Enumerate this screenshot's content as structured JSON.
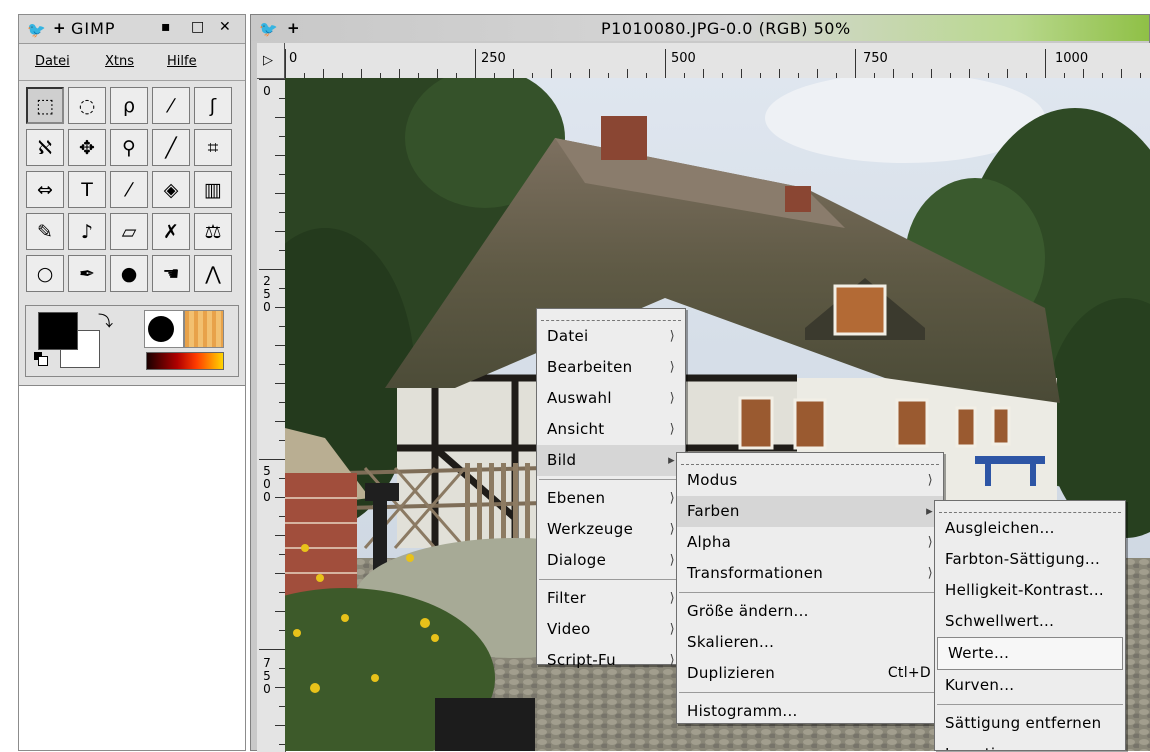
{
  "toolbox": {
    "title": "GIMP",
    "title_buttons": [
      "▪",
      "□",
      "✕"
    ],
    "menu": [
      "Datei",
      "Xtns",
      "Hilfe"
    ],
    "tools": [
      {
        "name": "rect-select-icon",
        "glyph": "⬚"
      },
      {
        "name": "ellipse-select-icon",
        "glyph": "◌"
      },
      {
        "name": "lasso-icon",
        "glyph": "ρ"
      },
      {
        "name": "magic-wand-icon",
        "glyph": "⁄"
      },
      {
        "name": "scissors-select-icon",
        "glyph": "ʃ"
      },
      {
        "name": "bezier-path-icon",
        "glyph": "ℵ"
      },
      {
        "name": "move-icon",
        "glyph": "✥"
      },
      {
        "name": "zoom-icon",
        "glyph": "⚲"
      },
      {
        "name": "measure-icon",
        "glyph": "╱"
      },
      {
        "name": "crop-icon",
        "glyph": "⌗"
      },
      {
        "name": "flip-icon",
        "glyph": "⇔"
      },
      {
        "name": "text-icon",
        "glyph": "T"
      },
      {
        "name": "color-picker-icon",
        "glyph": "⁄"
      },
      {
        "name": "bucket-fill-icon",
        "glyph": "◈"
      },
      {
        "name": "blend-icon",
        "glyph": "▥"
      },
      {
        "name": "pencil-icon",
        "glyph": "✎"
      },
      {
        "name": "paintbrush-icon",
        "glyph": "♪"
      },
      {
        "name": "eraser-icon",
        "glyph": "▱"
      },
      {
        "name": "airbrush-icon",
        "glyph": "✗"
      },
      {
        "name": "clone-icon",
        "glyph": "⚖"
      },
      {
        "name": "blur-icon",
        "glyph": "○"
      },
      {
        "name": "ink-icon",
        "glyph": "✒"
      },
      {
        "name": "dodge-burn-icon",
        "glyph": "●"
      },
      {
        "name": "smudge-icon",
        "glyph": "☚"
      },
      {
        "name": "measure-compass-icon",
        "glyph": "⋀"
      }
    ]
  },
  "image_window": {
    "title": "P1010080.JPG-0.0 (RGB) 50%",
    "corner_glyph": "▷",
    "hruler_labels": [
      "0",
      "250",
      "500",
      "750",
      "1000"
    ],
    "vruler_labels": [
      "0",
      "250",
      "500",
      "750"
    ]
  },
  "menus": {
    "main": [
      "Datei",
      "Bearbeiten",
      "Auswahl",
      "Ansicht",
      "Bild",
      "Ebenen",
      "Werkzeuge",
      "Dialoge",
      "Filter",
      "Video",
      "Script-Fu"
    ],
    "bild": [
      "Modus",
      "Farben",
      "Alpha",
      "Transformationen",
      "Größe ändern...",
      "Skalieren...",
      "Duplizieren",
      "Histogramm..."
    ],
    "bild_accel": "Ctl+D",
    "farben": [
      "Ausgleichen...",
      "Farbton-Sättigung...",
      "Helligkeit-Kontrast...",
      "Schwellwert...",
      "Werte...",
      "Kurven...",
      "Sättigung entfernen",
      "Invertieren"
    ]
  }
}
